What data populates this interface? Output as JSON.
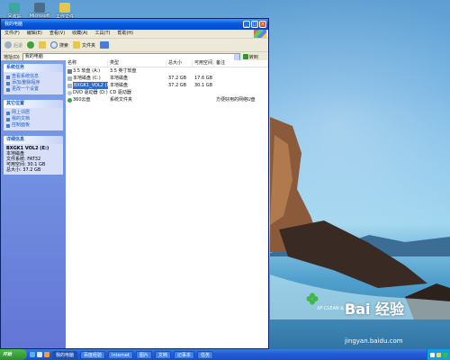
{
  "desktop": {
    "icons": [
      {
        "label": "回收站",
        "icon": "recycle-bin-icon",
        "color": "#3aa7a0"
      },
      {
        "label": "Microsoft",
        "icon": "app-shortcut-icon",
        "color": "#4e6b8a"
      },
      {
        "label": "工作文件",
        "icon": "folder-icon",
        "color": "#e8c64a"
      }
    ],
    "watermark": {
      "logo": "Bai 经验",
      "url": "jingyan.baidu.com",
      "tag": "XP CLEAN & LUCK"
    }
  },
  "window": {
    "title": "我的电脑",
    "menu": [
      "文件(F)",
      "编辑(E)",
      "查看(V)",
      "收藏(A)",
      "工具(T)",
      "帮助(H)"
    ],
    "toolbar": {
      "back": "后退",
      "forward": "",
      "up": "",
      "search": "搜索",
      "folders": "文件夹",
      "views": ""
    },
    "address": {
      "label": "地址(D)",
      "value": "我的电脑",
      "go": "转到"
    },
    "tasks": {
      "system": {
        "title": "系统任务",
        "items": [
          "查看系统信息",
          "添加/删除程序",
          "更改一个设置"
        ]
      },
      "other": {
        "title": "其它位置",
        "items": [
          "网上邻居",
          "我的文档",
          "控制面板"
        ]
      },
      "details": {
        "title": "详细信息",
        "lines": [
          "BXGK1 VOL2 (E:)",
          "本地磁盘",
          "文件系统: FAT32",
          "可用空间: 30.1 GB",
          "总大小: 37.2 GB"
        ]
      }
    },
    "list": {
      "columns": [
        "名称",
        "类型",
        "总大小",
        "可用空间",
        "备注"
      ],
      "rows": [
        {
          "name": "3.5 软盘 (A:)",
          "type": "3.5 英寸软盘",
          "total": "",
          "free": "",
          "note": "",
          "icon": "floppy-icon",
          "selected": false
        },
        {
          "name": "本地磁盘 (C:)",
          "type": "本地磁盘",
          "total": "37.2 GB",
          "free": "17.6 GB",
          "note": "",
          "icon": "hard-disk-icon",
          "selected": false
        },
        {
          "name": "BXGK1_VOL2 (E:)",
          "type": "本地磁盘",
          "total": "37.2 GB",
          "free": "30.1 GB",
          "note": "",
          "icon": "hard-disk-icon",
          "selected": true
        },
        {
          "name": "DVD 驱动器 (D:)",
          "type": "CD 驱动器",
          "total": "",
          "free": "",
          "note": "",
          "icon": "dvd-drive-icon",
          "selected": false
        },
        {
          "name": "360云盘",
          "type": "系统文件夹",
          "total": "",
          "free": "",
          "note": "方便好用的网络U盘",
          "icon": "cloud-drive-icon",
          "selected": false
        }
      ]
    }
  },
  "taskbar": {
    "start": "开始",
    "buttons": [
      {
        "label": "我的电脑",
        "active": true
      },
      {
        "label": "百度经验",
        "active": false
      },
      {
        "label": "Internet",
        "active": false
      },
      {
        "label": "图片",
        "active": false
      },
      {
        "label": "文档",
        "active": false
      },
      {
        "label": "记事本",
        "active": false
      },
      {
        "label": "任务",
        "active": false
      }
    ]
  },
  "colors": {
    "titlebar": "#0a5ddc",
    "task_pane": "#6375d6",
    "selection": "#316ac5",
    "start": "#2e8b2e"
  }
}
